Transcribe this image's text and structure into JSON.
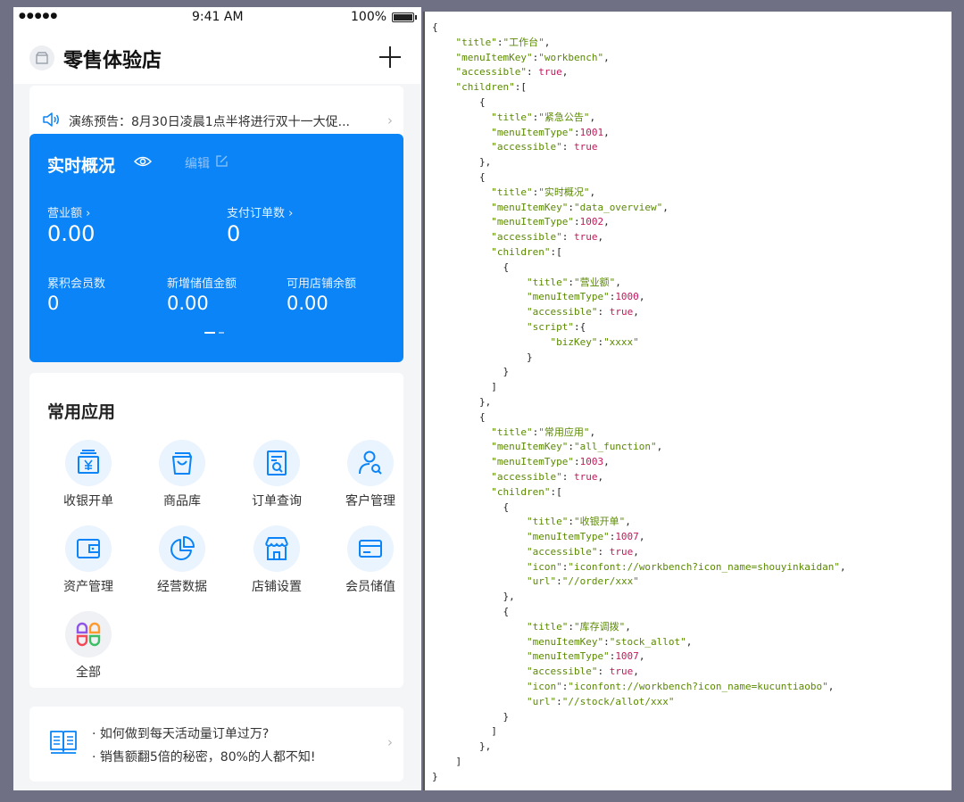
{
  "statusbar": {
    "signal": "●●●●●",
    "time": "9:41 AM",
    "battery": "100%"
  },
  "nav": {
    "title": "零售体验店",
    "add_icon": "plus-icon"
  },
  "notice": {
    "icon": "speaker-icon",
    "text": "演练预告：8月30日凌晨1点半将进行双十一大促...",
    "chevron": "›"
  },
  "overview": {
    "title": "实时概况",
    "edit_label": "编辑",
    "primary": [
      {
        "label": "营业额 ›",
        "value": "0.00"
      },
      {
        "label": "支付订单数 ›",
        "value": "0"
      }
    ],
    "secondary": [
      {
        "label": "累积会员数",
        "value": "0"
      },
      {
        "label": "新增储值金额",
        "value": "0.00"
      },
      {
        "label": "可用店铺余额",
        "value": "0.00"
      }
    ]
  },
  "apps": {
    "title": "常用应用",
    "items": [
      {
        "label": "收银开单",
        "icon": "cashier-icon"
      },
      {
        "label": "商品库",
        "icon": "shopping-bag-icon"
      },
      {
        "label": "订单查询",
        "icon": "order-search-icon"
      },
      {
        "label": "客户管理",
        "icon": "customer-search-icon"
      },
      {
        "label": "资产管理",
        "icon": "wallet-icon"
      },
      {
        "label": "经营数据",
        "icon": "pie-chart-icon"
      },
      {
        "label": "店铺设置",
        "icon": "store-icon"
      },
      {
        "label": "会员储值",
        "icon": "card-icon"
      },
      {
        "label": "全部",
        "icon": "all-apps-icon"
      }
    ]
  },
  "tips": {
    "icon": "book-icon",
    "lines": [
      "· 如何做到每天活动量订单过万?",
      "· 销售额翻5倍的秘密，80%的人都不知!"
    ],
    "chevron": "›"
  },
  "code": {
    "lines": [
      "{",
      "    \"title\":\"工作台\",",
      "    \"menuItemKey\":\"workbench\",",
      "    \"accessible\": true,",
      "    \"children\":[",
      "        {",
      "          \"title\":\"紧急公告\",",
      "          \"menuItemType\":1001,",
      "          \"accessible\": true",
      "        },",
      "        {",
      "          \"title\":\"实时概况\",",
      "          \"menuItemKey\":\"data_overview\",",
      "          \"menuItemType\":1002,",
      "          \"accessible\": true,",
      "          \"children\":[",
      "            {",
      "                \"title\":\"营业额\",",
      "                \"menuItemType\":1000,",
      "                \"accessible\": true,",
      "                \"script\":{",
      "                    \"bizKey\":\"xxxx\"",
      "                }",
      "            }",
      "          ]",
      "        },",
      "        {",
      "          \"title\":\"常用应用\",",
      "          \"menuItemKey\":\"all_function\",",
      "          \"menuItemType\":1003,",
      "          \"accessible\": true,",
      "          \"children\":[",
      "            {",
      "                \"title\":\"收银开单\",",
      "                \"menuItemType\":1007,",
      "                \"accessible\": true,",
      "                \"icon\":\"iconfont://workbench?icon_name=shouyinkaidan\",",
      "                \"url\":\"//order/xxx\"",
      "            },",
      "            {",
      "                \"title\":\"库存调拨\",",
      "                \"menuItemKey\":\"stock_allot\",",
      "                \"menuItemType\":1007,",
      "                \"accessible\": true,",
      "                \"icon\":\"iconfont://workbench?icon_name=kucuntiaobo\",",
      "                \"url\":\"//stock/allot/xxx\"",
      "            }",
      "          ]",
      "        },",
      "    ]",
      "}"
    ]
  },
  "colors": {
    "primary": "#0a84f6",
    "json_key": "#5a8a00",
    "json_literal": "#c2185b"
  }
}
